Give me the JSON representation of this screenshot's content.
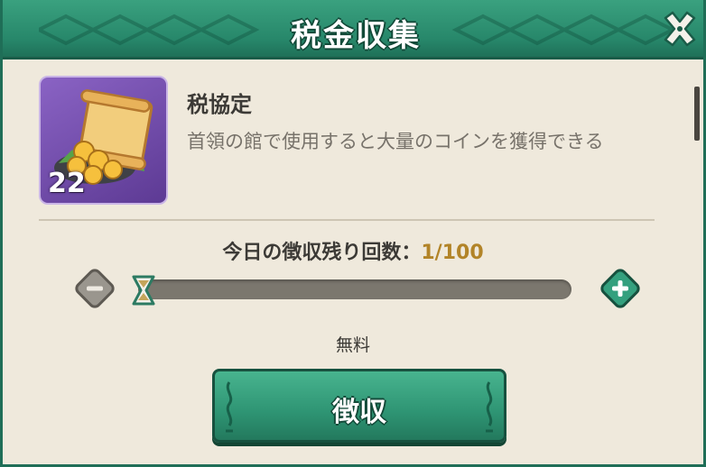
{
  "dialog": {
    "title": "税金収集",
    "close_icon": "close-icon"
  },
  "item": {
    "name": "税協定",
    "description": "首領の館で使用すると大量のコインを獲得できる",
    "count": "22",
    "icon": "tax-scroll-coins-icon"
  },
  "collection": {
    "remaining_label": "今日の徴収残り回数：",
    "remaining_value": "1/100",
    "slider_fraction": 0.0,
    "cost_label": "無料",
    "collect_button_label": "徴収"
  },
  "colors": {
    "primary_green": "#2e9473",
    "panel_bg": "#efe9dc",
    "item_bg": "#7a55b5",
    "count_accent": "#b28428"
  }
}
